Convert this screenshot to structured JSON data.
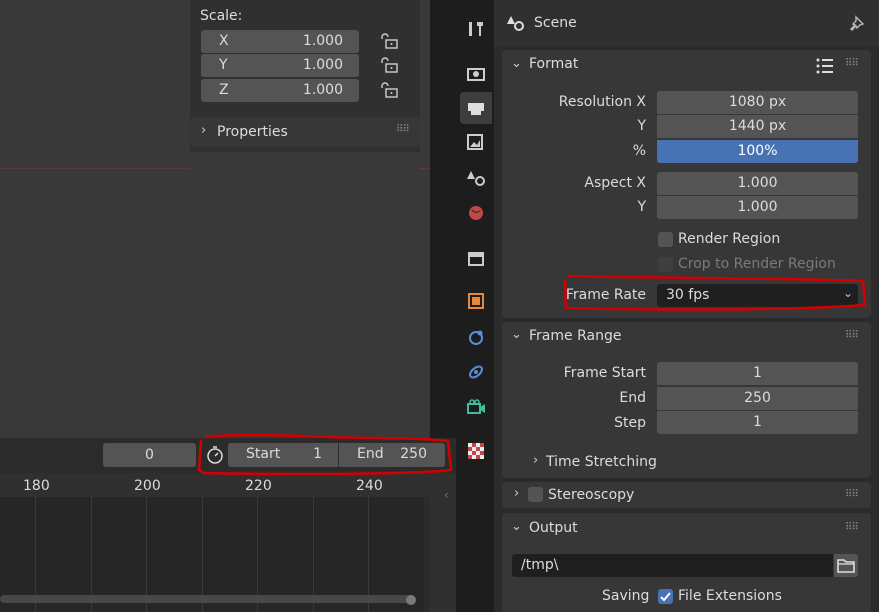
{
  "npanel": {
    "scale_label": "Scale:",
    "rows": [
      {
        "axis": "X",
        "value": "1.000"
      },
      {
        "axis": "Y",
        "value": "1.000"
      },
      {
        "axis": "Z",
        "value": "1.000"
      }
    ],
    "properties_label": "Properties"
  },
  "timeline": {
    "current_frame": "0",
    "start_label": "Start",
    "start_value": "1",
    "end_label": "End",
    "end_value": "250",
    "ruler_ticks": [
      "180",
      "200",
      "220",
      "240"
    ]
  },
  "properties": {
    "context_title": "Scene",
    "tabs": [
      "tool-icon",
      "render-icon",
      "output-icon",
      "view-layer-icon",
      "scene-icon",
      "world-icon",
      "collection-icon",
      "object-icon",
      "modifiers-icon",
      "particles-icon",
      "physics-icon",
      "constraints-icon",
      "data-icon",
      "texture-icon"
    ],
    "format": {
      "title": "Format",
      "resolution_x_label": "Resolution X",
      "resolution_x": "1080 px",
      "resolution_y_label": "Y",
      "resolution_y": "1440 px",
      "percent_label": "%",
      "percent": "100%",
      "aspect_x_label": "Aspect X",
      "aspect_x": "1.000",
      "aspect_y_label": "Y",
      "aspect_y": "1.000",
      "render_region": "Render Region",
      "crop_region": "Crop to Render Region",
      "frame_rate_label": "Frame Rate",
      "frame_rate": "30 fps"
    },
    "frame_range": {
      "title": "Frame Range",
      "start_label": "Frame Start",
      "start": "1",
      "end_label": "End",
      "end": "250",
      "step_label": "Step",
      "step": "1",
      "time_stretching": "Time Stretching"
    },
    "stereoscopy": {
      "title": "Stereoscopy"
    },
    "output": {
      "title": "Output",
      "path": "/tmp\\",
      "saving_label": "Saving",
      "file_extensions": "File Extensions"
    }
  },
  "colors": {
    "accent_blue": "#4772b3",
    "annotation_red": "#d40000"
  }
}
